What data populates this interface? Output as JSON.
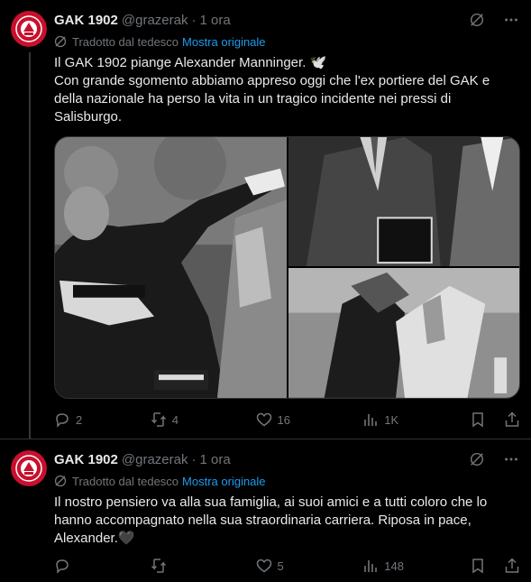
{
  "colors": {
    "accent": "#1d9bf0",
    "muted": "#71767b",
    "text": "#e7e9ea",
    "avatar_red": "#c8102e"
  },
  "tweets": [
    {
      "name": "GAK 1902",
      "handle": "@grazerak",
      "dot": "·",
      "time": "1 ora",
      "translated_label": "Tradotto dal tedesco",
      "show_original": "Mostra originale",
      "text": "Il GAK 1902 piange Alexander Manninger. 🕊️\nCon grande sgomento abbiamo appreso oggi che l'ex portiere del GAK e della nazionale ha perso la vita in un tragico incidente nei pressi di Salisburgo.",
      "media_icons": [
        "goalkeeper-photo",
        "men-suits-photo",
        "match-action-photo"
      ],
      "replies": "2",
      "reposts": "4",
      "likes": "16",
      "views": "1K"
    },
    {
      "name": "GAK 1902",
      "handle": "@grazerak",
      "dot": "·",
      "time": "1 ora",
      "translated_label": "Tradotto dal tedesco",
      "show_original": "Mostra originale",
      "text": "Il nostro pensiero va alla sua famiglia, ai suoi amici e a tutti coloro che lo hanno accompagnato nella sua straordinaria carriera. Riposa in pace, Alexander.🖤",
      "replies": "",
      "reposts": "",
      "likes": "5",
      "views": "148"
    }
  ]
}
